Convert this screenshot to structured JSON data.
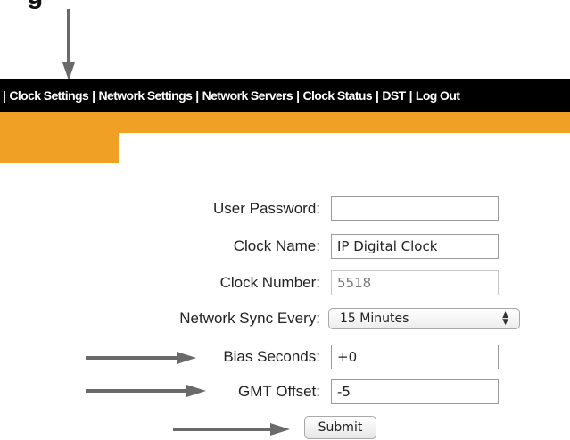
{
  "heading_fragment": "g",
  "nav": {
    "items": [
      "Clock Settings",
      "Network Settings",
      "Network Servers",
      "Clock Status",
      "DST",
      "Log Out"
    ],
    "separator": "|"
  },
  "form": {
    "user_password": {
      "label": "User Password:",
      "value": ""
    },
    "clock_name": {
      "label": "Clock Name:",
      "value": "IP Digital Clock"
    },
    "clock_number": {
      "label": "Clock Number:",
      "value": "5518"
    },
    "network_sync": {
      "label": "Network Sync Every:",
      "selected": "15 Minutes"
    },
    "bias_seconds": {
      "label": "Bias Seconds:",
      "value": "+0"
    },
    "gmt_offset": {
      "label": "GMT Offset:",
      "value": "-5"
    },
    "submit_label": "Submit"
  },
  "colors": {
    "nav_background": "#000000",
    "accent": "#f0a024",
    "arrow": "#6a6a6a"
  },
  "icons": {
    "down_arrow": "arrow-down-icon",
    "right_arrow": "arrow-right-icon",
    "select_arrows": "updown-chevron-icon"
  }
}
